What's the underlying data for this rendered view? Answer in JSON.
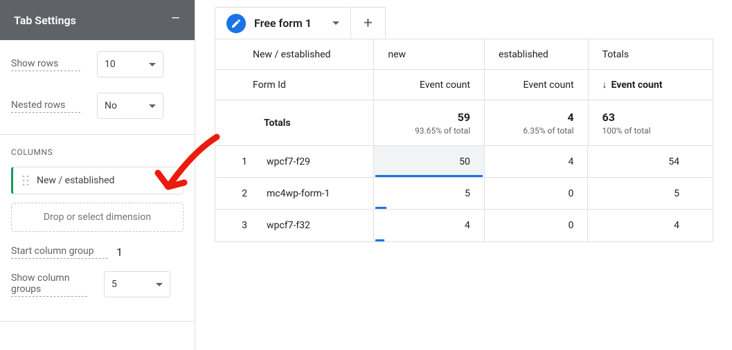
{
  "panel": {
    "title": "Tab Settings",
    "show_rows_label": "Show rows",
    "show_rows_value": "10",
    "nested_rows_label": "Nested rows",
    "nested_rows_value": "No",
    "columns_section": "COLUMNS",
    "column_chip": "New / established",
    "drop_placeholder": "Drop or select dimension",
    "start_col_group_label": "Start column group",
    "start_col_group_value": "1",
    "show_col_groups_label": "Show column groups",
    "show_col_groups_value": "5"
  },
  "tab": {
    "label": "Free form 1"
  },
  "table": {
    "dim_header": "New / established",
    "row_header": "Form Id",
    "col_new": "new",
    "col_est": "established",
    "col_totals": "Totals",
    "metric_label": "Event count",
    "totals_label": "Totals",
    "totals": {
      "new_count": "59",
      "new_pct": "93.65% of total",
      "est_count": "4",
      "est_pct": "6.35% of total",
      "total_count": "63",
      "total_pct": "100% of total"
    },
    "rows": [
      {
        "idx": "1",
        "form": "wpcf7-f29",
        "new": "50",
        "est": "4",
        "total": "54"
      },
      {
        "idx": "2",
        "form": "mc4wp-form-1",
        "new": "5",
        "est": "0",
        "total": "5"
      },
      {
        "idx": "3",
        "form": "wpcf7-f32",
        "new": "4",
        "est": "0",
        "total": "4"
      }
    ]
  }
}
